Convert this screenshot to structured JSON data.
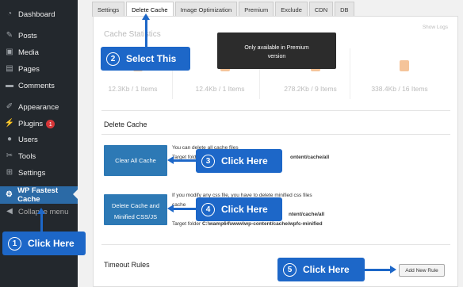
{
  "sidebar": {
    "items": [
      {
        "label": "Dashboard",
        "icon": "dashboard-icon"
      },
      {
        "label": "Posts",
        "icon": "pin-icon"
      },
      {
        "label": "Media",
        "icon": "media-icon"
      },
      {
        "label": "Pages",
        "icon": "pages-icon"
      },
      {
        "label": "Comments",
        "icon": "comments-icon"
      },
      {
        "label": "Appearance",
        "icon": "brush-icon"
      },
      {
        "label": "Plugins",
        "icon": "plugin-icon",
        "badge": "1"
      },
      {
        "label": "Users",
        "icon": "users-icon"
      },
      {
        "label": "Tools",
        "icon": "wrench-icon"
      },
      {
        "label": "Settings",
        "icon": "settings-icon"
      },
      {
        "label": "WP Fastest Cache",
        "icon": "fastest-cache-icon"
      },
      {
        "label": "Collapse menu",
        "icon": "collapse-icon"
      }
    ]
  },
  "tabs": [
    "Settings",
    "Delete Cache",
    "Image Optimization",
    "Premium",
    "Exclude",
    "CDN",
    "DB"
  ],
  "active_tab": "Delete Cache",
  "cache_statistics": {
    "title": "Cache Statistics",
    "show_logs": "Show Logs",
    "stats": [
      "12.3Kb / 1 Items",
      "12.4Kb / 1 Items",
      "278.2Kb / 9 Items",
      "338.4Kb / 16 Items"
    ]
  },
  "premium_tooltip": {
    "line1": "Only available in Premium",
    "line2": "version"
  },
  "delete_cache": {
    "title": "Delete Cache",
    "clear_all_button": "Clear All Cache",
    "clear_all_desc_line1": "You can delete all cache files",
    "clear_all_desc_line2_prefix": "Target folder",
    "clear_all_desc_line2_path": "ontent/cache/all",
    "clear_min_button_line1": "Delete Cache and",
    "clear_min_button_line2": "Minified CSS/JS",
    "clear_min_desc_line1": "If you modify any css file, you have to delete minified css files",
    "clear_min_desc_line2": "cache",
    "clear_min_desc_line3_path": "ntent/cache/all",
    "clear_min_desc_line4_prefix": "Target folder",
    "clear_min_desc_line4_path": "C:\\wamp64\\www\\wp-content/cache/wpfc-minified"
  },
  "timeout_rules": {
    "title": "Timeout Rules",
    "add_button": "Add New Rule"
  },
  "callouts": [
    {
      "num": "1",
      "label": "Click Here"
    },
    {
      "num": "2",
      "label": "Select This"
    },
    {
      "num": "3",
      "label": "Click Here"
    },
    {
      "num": "4",
      "label": "Click Here"
    },
    {
      "num": "5",
      "label": "Click Here"
    }
  ],
  "colors": {
    "sidebar_bg": "#23282d",
    "active_menu": "#2b6aa6",
    "button_blue": "#2d79b5",
    "callout_blue": "#1d67c8"
  }
}
